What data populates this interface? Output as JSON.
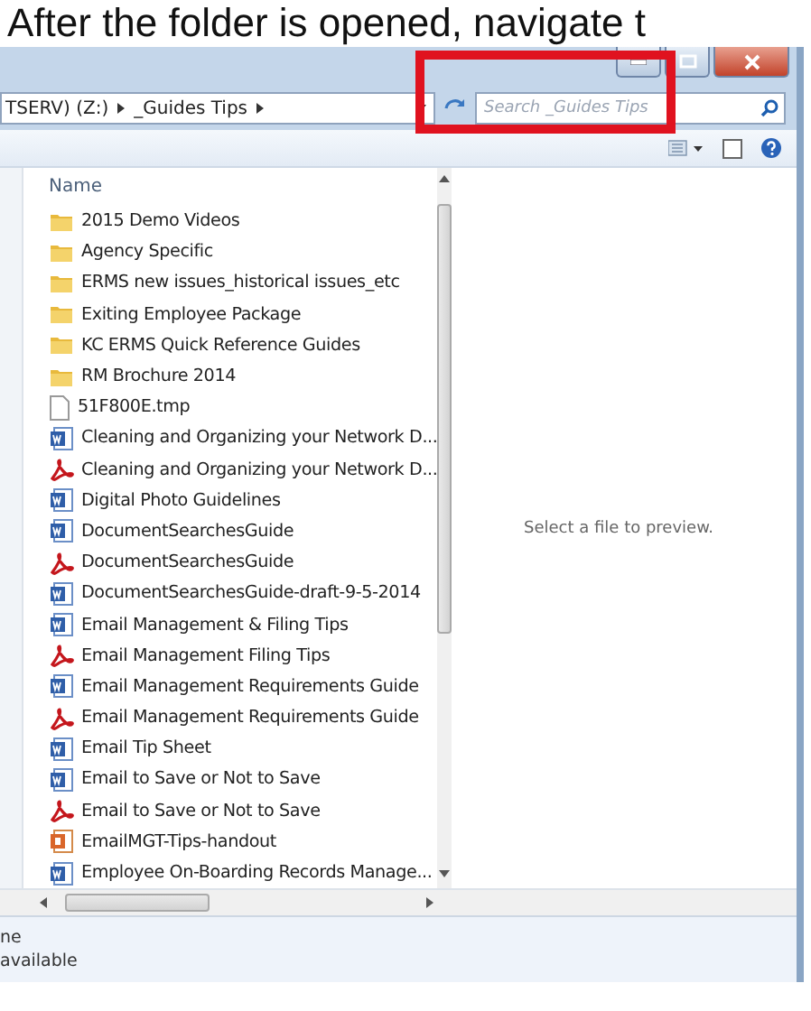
{
  "heading": "After the folder is opened, navigate t",
  "address": {
    "crumbs": [
      "TSERV) (Z:)",
      "_Guides Tips"
    ],
    "search_placeholder": "Search _Guides Tips"
  },
  "column_header": "Name",
  "files": [
    {
      "name": "2015 Demo Videos",
      "kind": "folder"
    },
    {
      "name": "Agency Specific",
      "kind": "folder"
    },
    {
      "name": "ERMS new issues_historical issues_etc",
      "kind": "folder"
    },
    {
      "name": "Exiting Employee Package",
      "kind": "folder"
    },
    {
      "name": "KC ERMS Quick Reference Guides",
      "kind": "folder"
    },
    {
      "name": "RM Brochure 2014",
      "kind": "folder"
    },
    {
      "name": "51F800E.tmp",
      "kind": "blank"
    },
    {
      "name": "Cleaning and Organizing your Network D...",
      "kind": "word"
    },
    {
      "name": "Cleaning and Organizing your Network D...",
      "kind": "pdf"
    },
    {
      "name": "Digital Photo Guidelines",
      "kind": "word"
    },
    {
      "name": "DocumentSearchesGuide",
      "kind": "word"
    },
    {
      "name": "DocumentSearchesGuide",
      "kind": "pdf"
    },
    {
      "name": "DocumentSearchesGuide-draft-9-5-2014",
      "kind": "word"
    },
    {
      "name": "Email Management & Filing Tips",
      "kind": "word"
    },
    {
      "name": "Email Management Filing Tips",
      "kind": "pdf"
    },
    {
      "name": "Email Management Requirements Guide",
      "kind": "word"
    },
    {
      "name": "Email Management Requirements Guide",
      "kind": "pdf"
    },
    {
      "name": "Email Tip Sheet",
      "kind": "word"
    },
    {
      "name": "Email to Save or Not to Save",
      "kind": "word"
    },
    {
      "name": "Email to Save or Not to Save",
      "kind": "pdf"
    },
    {
      "name": "EmailMGT-Tips-handout",
      "kind": "slides"
    },
    {
      "name": "Employee On-Boarding Records Manage...",
      "kind": "word"
    }
  ],
  "preview_message": "Select a file to preview.",
  "details": [
    "ne",
    "available"
  ]
}
